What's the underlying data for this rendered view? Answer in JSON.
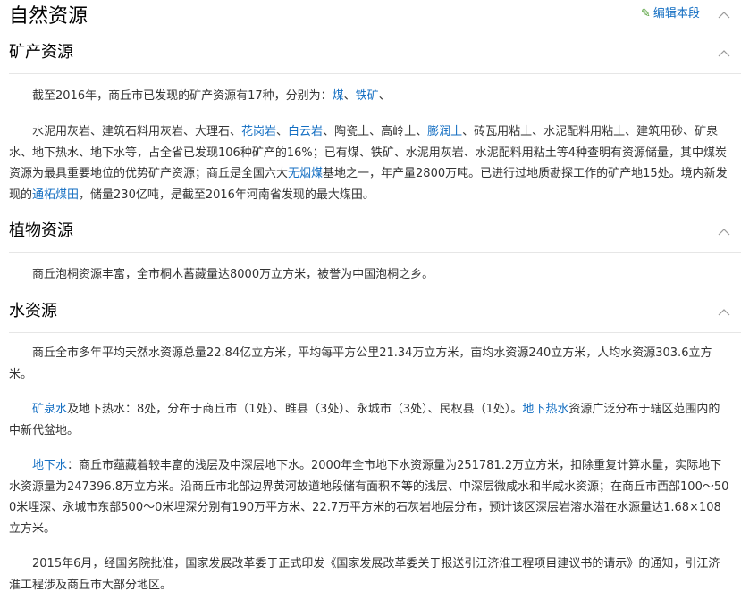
{
  "main_title": "自然资源",
  "edit_label": "编辑本段",
  "sections": {
    "minerals": {
      "title": "矿产资源",
      "p1": {
        "t1": "截至2016年，商丘市已发现的矿产资源有17种，分别为：",
        "l1": "煤",
        "t2": "、",
        "l2": "铁矿",
        "t3": "、"
      },
      "p2": {
        "t1": "水泥用灰岩、建筑石料用灰岩、大理石、",
        "l1": "花岗岩",
        "t2": "、",
        "l2": "白云岩",
        "t3": "、陶瓷土、高岭土、",
        "l3": "膨润土",
        "t4": "、砖瓦用粘土、水泥配料用粘土、建筑用砂、矿泉水、地下热水、地下水等，占全省已发现106种矿产的16%；已有煤、铁矿、水泥用灰岩、水泥配料用粘土等4种查明有资源储量，其中煤炭资源为最具重要地位的优势矿产资源；商丘是全国六大",
        "l4": "无烟煤",
        "t5": "基地之一，年产量2800万吨。已进行过地质勘探工作的矿产地15处。境内新发现的",
        "l5": "通柘煤田",
        "t6": "，储量230亿吨，是截至2016年河南省发现的最大煤田。"
      }
    },
    "plants": {
      "title": "植物资源",
      "p1": "商丘泡桐资源丰富，全市桐木蓄藏量达8000万立方米，被誉为中国泡桐之乡。"
    },
    "water": {
      "title": "水资源",
      "p1": "商丘全市多年平均天然水资源总量22.84亿立方米，平均每平方公里21.34万立方米，亩均水资源240立方米，人均水资源303.6立方米。",
      "p2": {
        "l1": "矿泉水",
        "t1": "及地下热水：8处，分布于商丘市（1处）、睢县（3处）、永城市（3处）、民权县（1处）。",
        "l2": "地下热水",
        "t2": "资源广泛分布于辖区范围内的中新代盆地。"
      },
      "p3": {
        "l1": "地下水",
        "t1": "：商丘市蕴藏着较丰富的浅层及中深层地下水。2000年全市地下水资源量为251781.2万立方米，扣除重复计算水量，实际地下水资源量为247396.8万立方米。沿商丘市北部边界黄河故道地段储有面积不等的浅层、中深层微咸水和半咸水资源；在商丘市西部100～500米埋深、永城市东部500～0米埋深分别有190万平方米、22.7万平方米的石灰岩地层分布，预计该区深层岩溶水潜在水源量达1.68×108立方米。"
      },
      "p4": "2015年6月，经国务院批准，国家发展改革委于正式印发《国家发展改革委关于报送引江济淮工程项目建议书的请示》的通知，引江济淮工程涉及商丘市大部分地区。"
    }
  }
}
